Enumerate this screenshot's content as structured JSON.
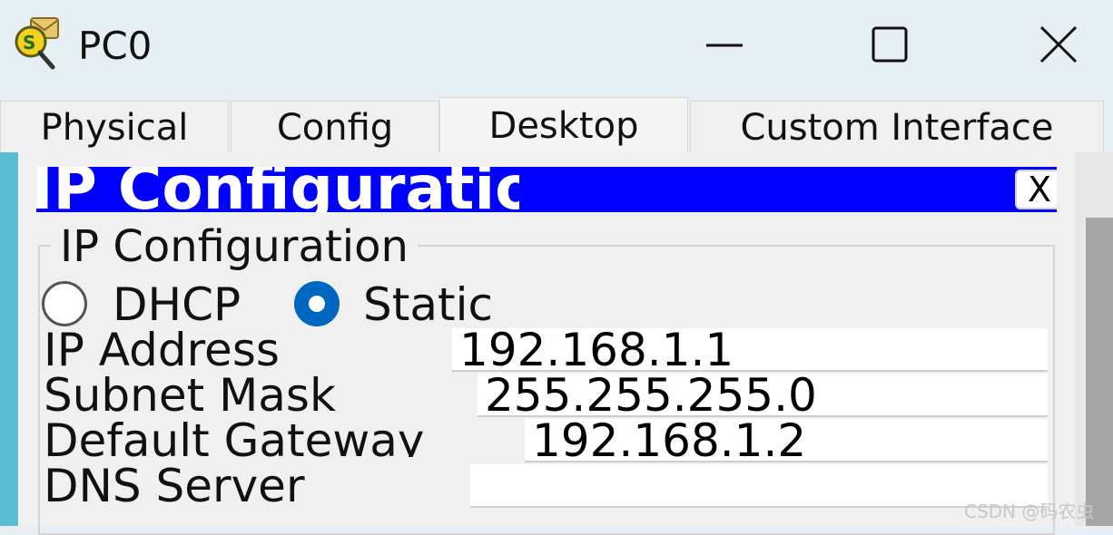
{
  "window": {
    "title": "PC0",
    "app_icon": "packet-tracer-pc-icon",
    "controls": [
      "minimize-icon",
      "maximize-icon",
      "close-icon"
    ]
  },
  "tabs": [
    {
      "label": "Physical",
      "active": false
    },
    {
      "label": "Config",
      "active": false
    },
    {
      "label": "Desktop",
      "active": true
    },
    {
      "label": "Custom Interface",
      "active": false
    }
  ],
  "dialog": {
    "title_bar": "IP Configuration",
    "close_label": "X",
    "bar_color": "#0000ff"
  },
  "ip_config": {
    "group_title": "IP Configuration",
    "mode_options": [
      {
        "label": "DHCP",
        "selected": false
      },
      {
        "label": "Static",
        "selected": true
      }
    ],
    "fields": [
      {
        "label": "IP Address",
        "value": "192.168.1.1"
      },
      {
        "label": "Subnet Mask",
        "value": "255.255.255.0"
      },
      {
        "label": "Default Gateway",
        "value": "192.168.1.2"
      },
      {
        "label": "DNS Server",
        "value": ""
      }
    ]
  },
  "watermark": "CSDN @码农虫",
  "colors": {
    "accent": "#0067c0",
    "side_strip": "#5bbcd3"
  }
}
